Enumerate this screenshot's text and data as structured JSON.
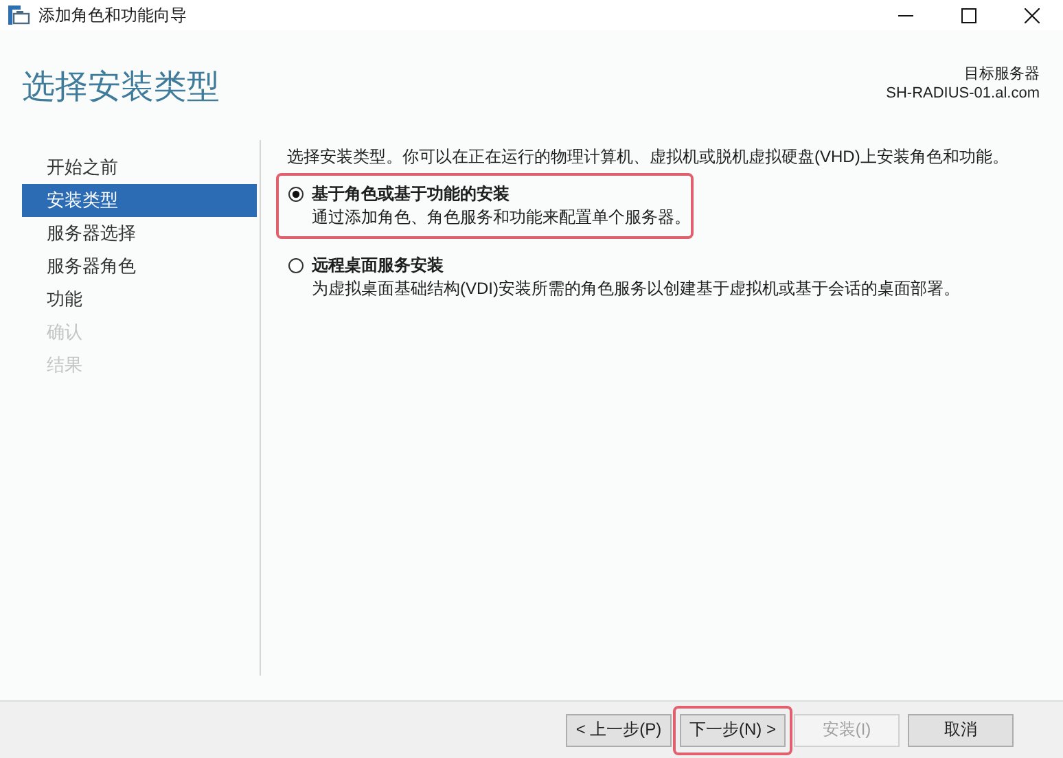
{
  "window": {
    "title": "添加角色和功能向导"
  },
  "header": {
    "title": "选择安装类型",
    "target_label": "目标服务器",
    "target_server": "SH-RADIUS-01.al.com"
  },
  "steps": [
    {
      "label": "开始之前",
      "selected": false,
      "disabled": false
    },
    {
      "label": "安装类型",
      "selected": true,
      "disabled": false
    },
    {
      "label": "服务器选择",
      "selected": false,
      "disabled": false
    },
    {
      "label": "服务器角色",
      "selected": false,
      "disabled": false
    },
    {
      "label": "功能",
      "selected": false,
      "disabled": false
    },
    {
      "label": "确认",
      "selected": false,
      "disabled": true
    },
    {
      "label": "结果",
      "selected": false,
      "disabled": true
    }
  ],
  "intro": "选择安装类型。你可以在正在运行的物理计算机、虚拟机或脱机虚拟硬盘(VHD)上安装角色和功能。",
  "options": [
    {
      "label": "基于角色或基于功能的安装",
      "description": "通过添加角色、角色服务和功能来配置单个服务器。",
      "selected": true,
      "highlighted": true
    },
    {
      "label": "远程桌面服务安装",
      "description": "为虚拟桌面基础结构(VDI)安装所需的角色服务以创建基于虚拟机或基于会话的桌面部署。",
      "selected": false,
      "highlighted": false
    }
  ],
  "buttons": [
    {
      "label": "< 上一步(P)",
      "disabled": false,
      "highlighted": false
    },
    {
      "label": "下一步(N) >",
      "disabled": false,
      "highlighted": true
    },
    {
      "label": "安装(I)",
      "disabled": true,
      "highlighted": false
    },
    {
      "label": "取消",
      "disabled": false,
      "highlighted": false
    }
  ]
}
